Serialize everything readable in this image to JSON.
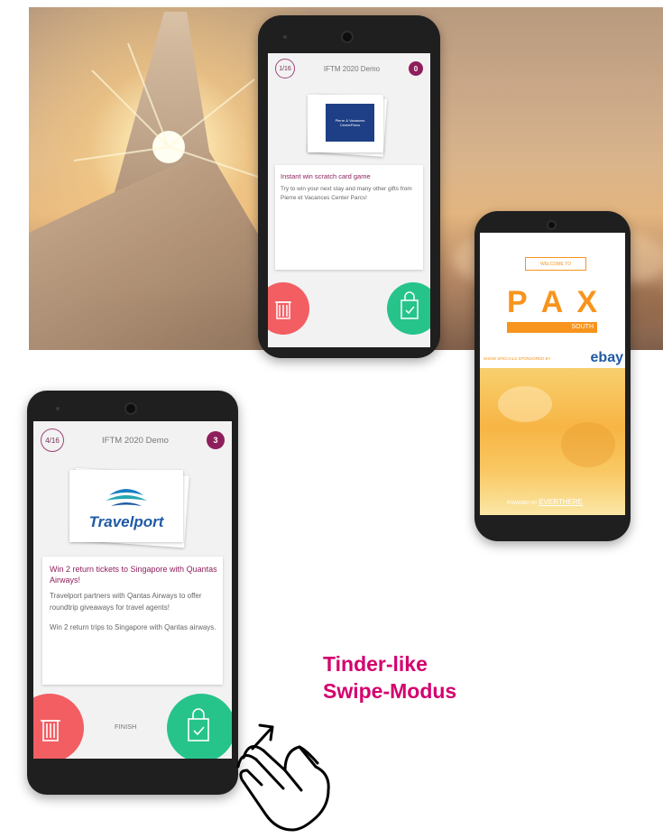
{
  "phone_top": {
    "counter": "1/16",
    "title": "IFTM 2020 Demo",
    "badge": "0",
    "logo_lines": [
      "Pierre & Vacances",
      "CenterParcs"
    ],
    "card_title": "Instant win scratch card game",
    "card_body": "Try to win your next stay and many other gifts from Pierre et Vacances Center Parcs!"
  },
  "phone_pax": {
    "welcome": "WELCOME TO",
    "brand_letters": [
      "P",
      "A",
      "X"
    ],
    "south": "SOUTH",
    "sponsor": "SHOW SPECIALS SPONSORED BY",
    "ebay": "ebay",
    "powered_by": "POWERED BY",
    "powered_brand": "EVERTHERE"
  },
  "phone_main": {
    "counter": "4/16",
    "title": "IFTM 2020 Demo",
    "badge": "3",
    "logo_text": "Travelport",
    "card_title": "Win 2 return tickets to Singapore with Quantas Airways!",
    "card_body_1": "Travelport partners with Qantas Airways to offer roundtrip giveaways for travel agents!",
    "card_body_2": "Win 2 return trips to Singapore with Qantas airways.",
    "finish": "FINISH"
  },
  "caption": {
    "line1": "Tinder-like",
    "line2": "Swipe-Modus"
  },
  "colors": {
    "accent": "#8e1f5c",
    "caption": "#d4006d",
    "trash": "#f25e62",
    "bag": "#26c48b",
    "pax_orange": "#f7941d",
    "travelport_blue": "#1f5aa6"
  },
  "icons": [
    "trash-icon",
    "shopping-bag-check-icon",
    "swipe-hand-icon"
  ]
}
